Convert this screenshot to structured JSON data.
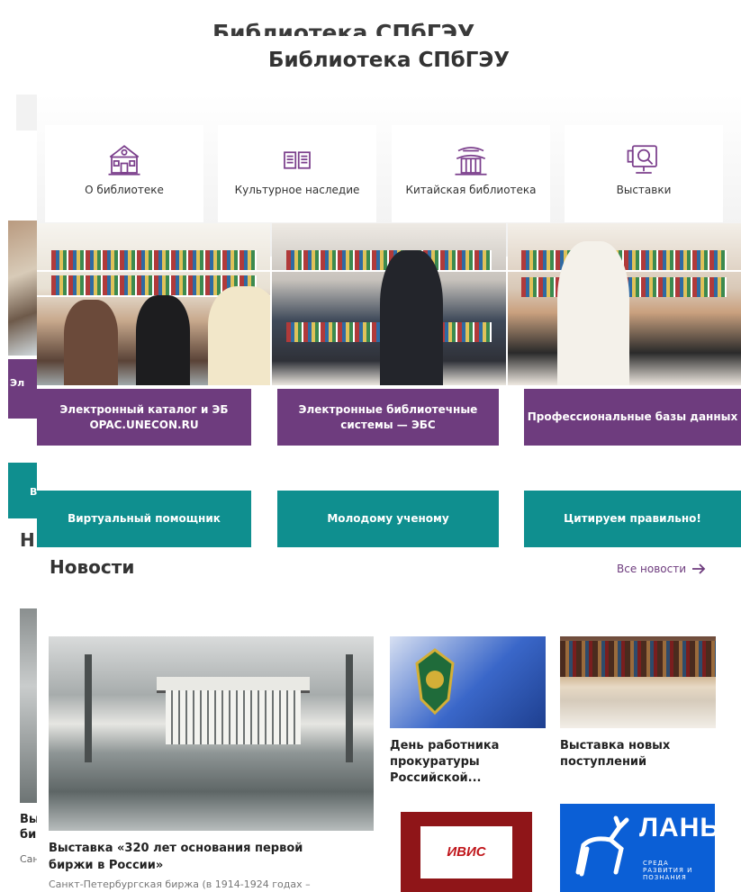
{
  "page_title": "Библиотека СПбГЭУ",
  "tiles": [
    {
      "label": "О библиотеке",
      "icon": "library-building-icon"
    },
    {
      "label": "Культурное наследие",
      "icon": "book-icon"
    },
    {
      "label": "Китайская библиотека",
      "icon": "pagoda-icon"
    },
    {
      "label": "Выставки",
      "icon": "exhibition-display-icon"
    }
  ],
  "purple_buttons": [
    "Электронный каталог и ЭБ OPAC.UNECON.RU",
    "Электронные библиотечные системы — ЭБС",
    "Профессиональные базы данных"
  ],
  "teal_buttons": [
    "Виртуальный помощник",
    "Молодому ученому",
    "Цитируем правильно!"
  ],
  "news": {
    "heading": "Новости",
    "all_news_label": "Все новости",
    "main_item": {
      "title": "Выставка «320 лет основания первой биржи в России»",
      "excerpt": "Санкт-Петербургская биржа (в 1914-1924 годах –"
    },
    "items": [
      {
        "title": "День работника прокуратуры Российской..."
      },
      {
        "title": "Выставка новых поступлений"
      }
    ],
    "logos": {
      "ivis": "ИВИС",
      "lan_word": "ЛАНЬ",
      "lan_sub": "СРЕДА РАЗВИТИЯ И ПОЗНАНИЯ"
    }
  },
  "ghost": {
    "title": "Библиотека СПбГЭУ",
    "purple_fragment": "Эл",
    "teal_fragment": "В",
    "heading_fragment": "Н",
    "news_fragment": "Вы би",
    "excerpt_fragment": "Сан"
  },
  "colors": {
    "purple": "#6e3c7e",
    "teal": "#0f8f8f"
  }
}
